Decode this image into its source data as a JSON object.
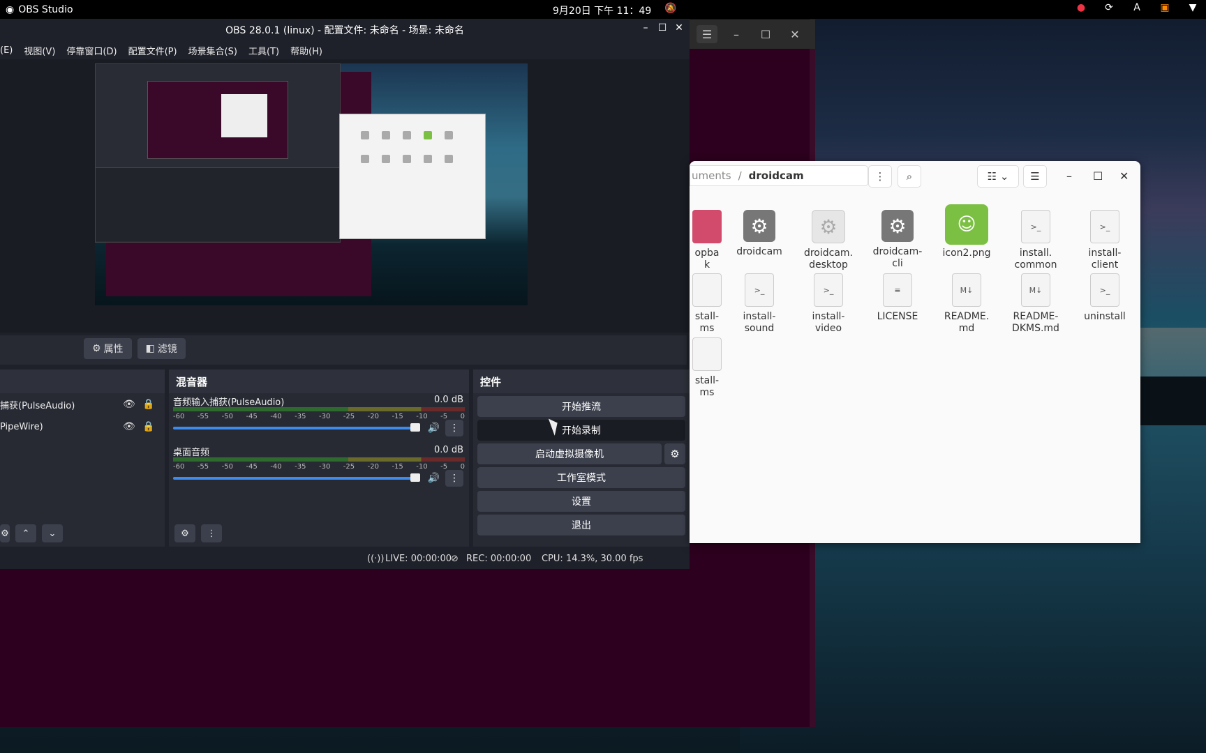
{
  "topbar": {
    "app_name": "OBS Studio",
    "clock": "9月20日 下午 11：49",
    "tray": [
      "firefox-icon",
      "sync-icon",
      "A",
      "screen-icon",
      "wifi-icon"
    ]
  },
  "obs": {
    "title": "OBS 28.0.1 (linux) - 配置文件: 未命名 - 场景: 未命名",
    "menu": [
      "(E)",
      "视图(V)",
      "停靠窗口(D)",
      "配置文件(P)",
      "场景集合(S)",
      "工具(T)",
      "帮助(H)"
    ],
    "toolbar": {
      "properties": "属性",
      "filters": "滤镜"
    },
    "sources": {
      "items": [
        {
          "label": "捕获(PulseAudio)"
        },
        {
          "label": "PipeWire)"
        }
      ]
    },
    "mixer": {
      "title": "混音器",
      "channels": [
        {
          "name": "音频输入捕获(PulseAudio)",
          "db": "0.0 dB",
          "level": 1.0
        },
        {
          "name": "桌面音频",
          "db": "0.0 dB",
          "level": 1.0
        }
      ],
      "ticks": [
        "-60",
        "-55",
        "-50",
        "-45",
        "-40",
        "-35",
        "-30",
        "-25",
        "-20",
        "-15",
        "-10",
        "-5",
        "0"
      ]
    },
    "controls": {
      "title": "控件",
      "start_stream": "开始推流",
      "start_record": "开始录制",
      "virtual_cam": "启动虚拟摄像机",
      "studio_mode": "工作室模式",
      "settings": "设置",
      "exit": "退出"
    },
    "status": {
      "live": "LIVE: 00:00:00",
      "rec": "REC: 00:00:00",
      "cpu": "CPU: 14.3%, 30.00 fps"
    }
  },
  "filemanager": {
    "breadcrumb_prev": "uments",
    "breadcrumb_sep": "/",
    "breadcrumb_current": "droidcam",
    "files": [
      {
        "name": "opba\nk",
        "type": "partial"
      },
      {
        "name": "droidcam",
        "type": "gear"
      },
      {
        "name": "droidcam.\ndesktop",
        "type": "gear-light"
      },
      {
        "name": "droidcam-\ncli",
        "type": "gear"
      },
      {
        "name": "icon2.png",
        "type": "android"
      },
      {
        "name": "install.\ncommon",
        "type": "doc"
      },
      {
        "name": "install-\nclient",
        "type": "doc"
      },
      {
        "name": "stall-\nms",
        "type": "partial"
      },
      {
        "name": "install-\nsound",
        "type": "doc"
      },
      {
        "name": "install-\nvideo",
        "type": "doc"
      },
      {
        "name": "LICENSE",
        "type": "text"
      },
      {
        "name": "README.\nmd",
        "type": "md"
      },
      {
        "name": "README-\nDKMS.md",
        "type": "md"
      },
      {
        "name": "uninstall",
        "type": "doc"
      },
      {
        "name": "stall-\nms",
        "type": "partial"
      }
    ]
  }
}
